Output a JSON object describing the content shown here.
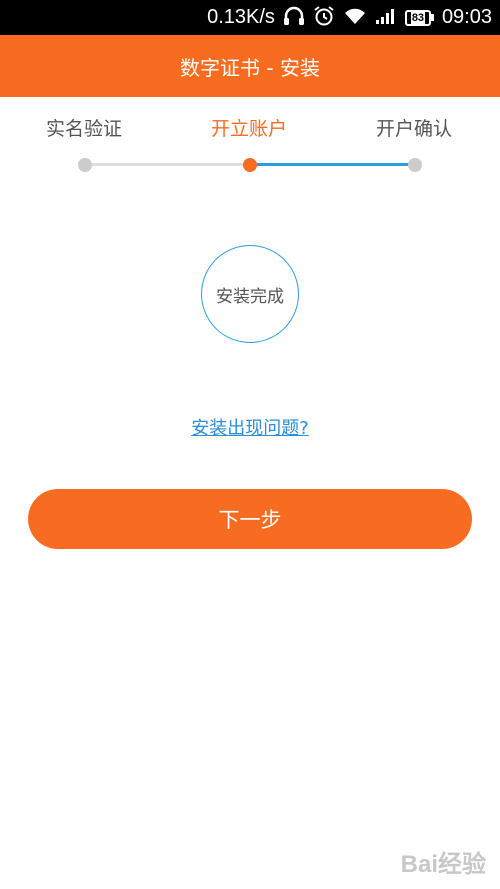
{
  "status_bar": {
    "net_speed": "0.13K/s",
    "battery_level": "83",
    "time": "09:03",
    "icons": [
      "headphones-icon",
      "alarm-icon",
      "wifi-icon",
      "signal-icon",
      "battery-icon"
    ]
  },
  "header": {
    "title": "数字证书 - 安装"
  },
  "steps": [
    {
      "label": "实名验证",
      "state": "done"
    },
    {
      "label": "开立账户",
      "state": "active"
    },
    {
      "label": "开户确认",
      "state": "pending"
    }
  ],
  "colors": {
    "brand": "#f86c22",
    "accent_blue": "#2a9de0",
    "grey": "#cccccc"
  },
  "status_circle": {
    "label": "安装完成"
  },
  "help_link": {
    "label": "安装出现问题?"
  },
  "next_button": {
    "label": "下一步"
  },
  "watermark": {
    "text": "Bai经验"
  }
}
